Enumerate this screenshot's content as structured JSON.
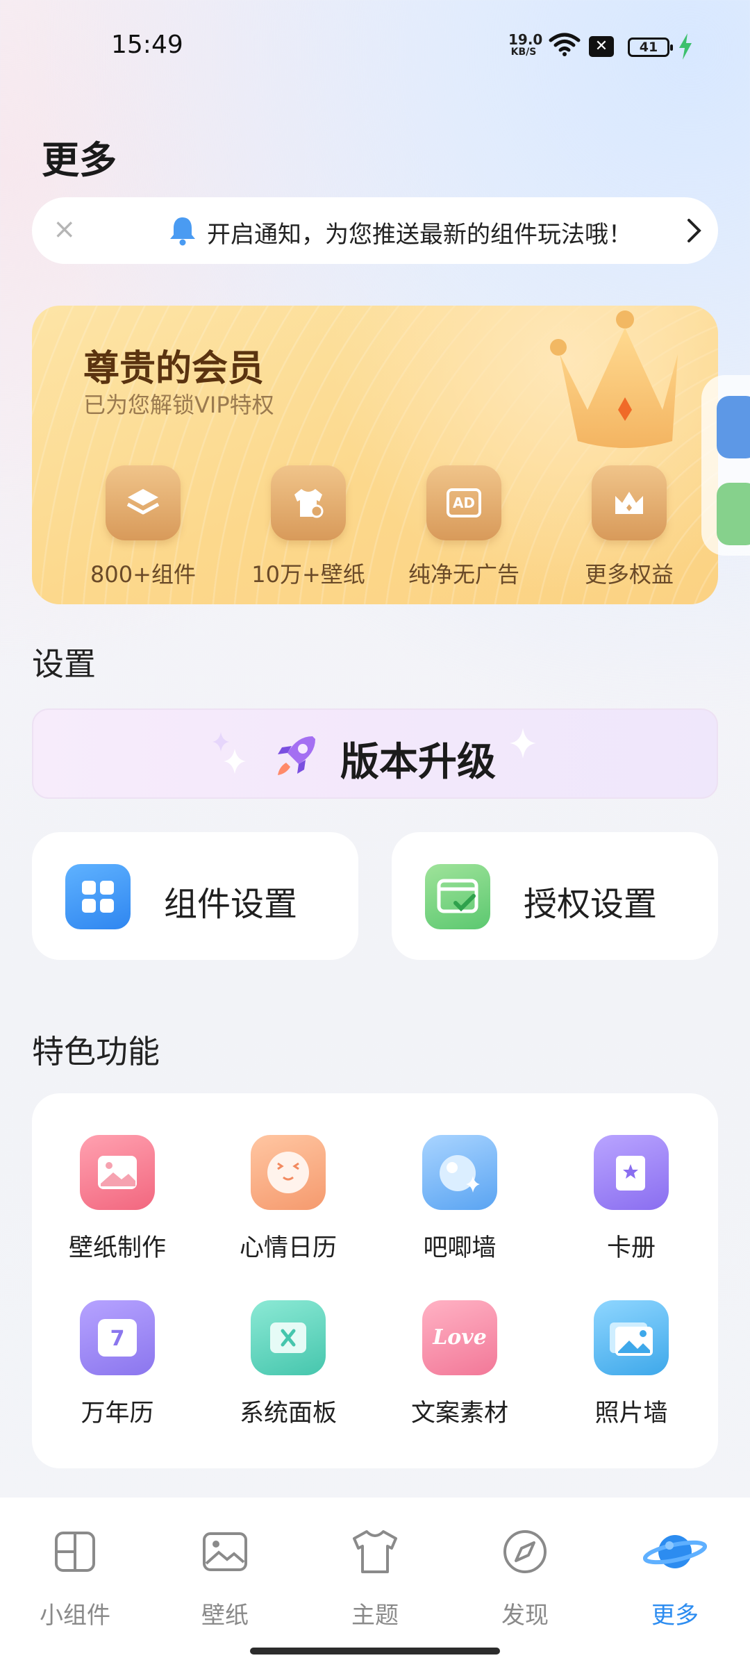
{
  "status": {
    "time": "15:49",
    "net_speed_value": "19.0",
    "net_speed_unit": "KB/S",
    "battery": "41"
  },
  "page_title": "更多",
  "notice": {
    "text": "开启通知，为您推送最新的组件玩法哦！",
    "close": "×"
  },
  "vip": {
    "title": "尊贵的会员",
    "subtitle": "已为您解锁VIP特权",
    "perks": [
      {
        "label": "800+组件",
        "icon": "layers-icon"
      },
      {
        "label": "10万+壁纸",
        "icon": "tshirt-icon"
      },
      {
        "label": "纯净无广告",
        "icon": "ad-icon"
      },
      {
        "label": "更多权益",
        "icon": "crown-icon"
      }
    ],
    "ad_text": "AD"
  },
  "settings": {
    "heading": "设置",
    "upgrade_label": "版本升级",
    "cards": [
      {
        "label": "组件设置",
        "icon": "grid-icon"
      },
      {
        "label": "授权设置",
        "icon": "authorize-icon"
      }
    ]
  },
  "features": {
    "heading": "特色功能",
    "items": [
      {
        "label": "壁纸制作",
        "icon": "wallpaper-make-icon",
        "color": "#f47a90"
      },
      {
        "label": "心情日历",
        "icon": "mood-calendar-icon",
        "color": "#f7a27a"
      },
      {
        "label": "吧唧墙",
        "icon": "badge-wall-icon",
        "color": "#6fb2f4"
      },
      {
        "label": "卡册",
        "icon": "card-album-icon",
        "color": "#9a7cf2"
      },
      {
        "label": "万年历",
        "icon": "calendar-icon",
        "color": "#9a88ee",
        "day": "7"
      },
      {
        "label": "系统面板",
        "icon": "system-panel-icon",
        "color": "#5cd6bf"
      },
      {
        "label": "文案素材",
        "icon": "copywriting-icon",
        "color": "#f5809c",
        "art": "Love"
      },
      {
        "label": "照片墙",
        "icon": "photo-wall-icon",
        "color": "#4fb6ec"
      }
    ]
  },
  "tabs": [
    {
      "label": "小组件"
    },
    {
      "label": "壁纸"
    },
    {
      "label": "主题"
    },
    {
      "label": "发现"
    },
    {
      "label": "更多",
      "active": true
    }
  ],
  "colors": {
    "accent": "#2c8cf0",
    "vip_gold": "#fbd283"
  }
}
